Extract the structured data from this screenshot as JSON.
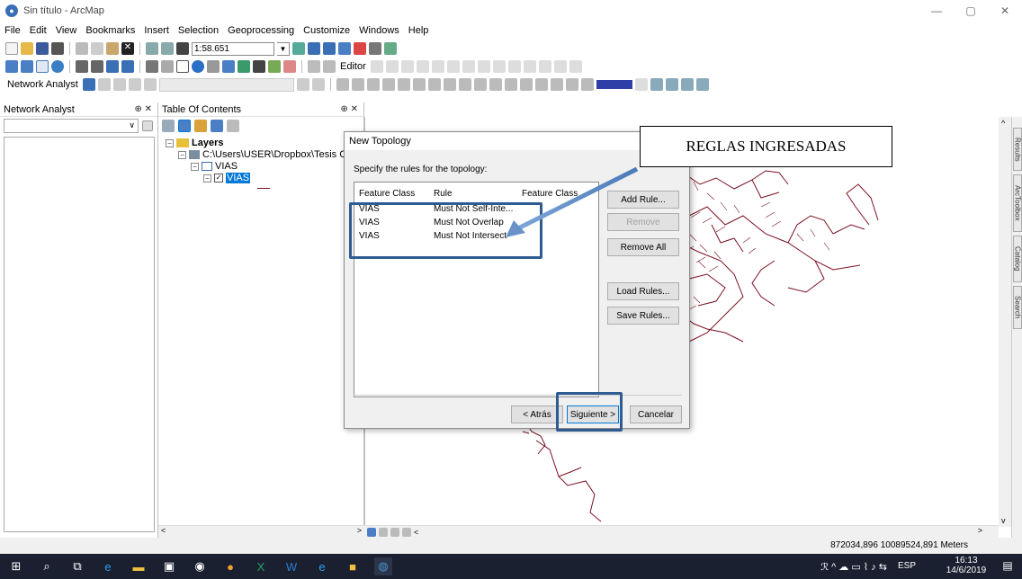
{
  "window": {
    "title": "Sin título - ArcMap"
  },
  "menu": [
    "File",
    "Edit",
    "View",
    "Bookmarks",
    "Insert",
    "Selection",
    "Geoprocessing",
    "Customize",
    "Windows",
    "Help"
  ],
  "toolbar": {
    "scale": "1:58.651",
    "editor_label": "Editor",
    "network_analyst_label": "Network Analyst"
  },
  "network_analyst_panel": {
    "title": "Network Analyst"
  },
  "toc": {
    "title": "Table Of Contents",
    "layers_label": "Layers",
    "path_label": "C:\\Users\\USER\\Dropbox\\Tesis Casc",
    "group_label": "VIAS",
    "layer_label": "VIAS"
  },
  "dialog": {
    "title": "New Topology",
    "prompt": "Specify the rules for the topology:",
    "columns": [
      "Feature Class",
      "Rule",
      "Feature Class"
    ],
    "rules": [
      {
        "feature_class": "VIAS",
        "rule": "Must Not Self-Inte..."
      },
      {
        "feature_class": "VIAS",
        "rule": "Must Not Overlap"
      },
      {
        "feature_class": "VIAS",
        "rule": "Must Not Intersect"
      }
    ],
    "buttons": {
      "add_rule": "Add Rule...",
      "remove": "Remove",
      "remove_all": "Remove All",
      "load_rules": "Load Rules...",
      "save_rules": "Save Rules...",
      "back": "< Atrás",
      "next": "Siguiente >",
      "cancel": "Cancelar"
    }
  },
  "annotation": {
    "text": "REGLAS INGRESADAS"
  },
  "side_tabs": [
    "Results",
    "ArcToolbox",
    "Catalog",
    "Search"
  ],
  "status": {
    "coordinates": "872034,896 10089524,891 Meters"
  },
  "taskbar": {
    "lang": "ESP",
    "time": "16:13",
    "date": "14/6/2019",
    "notify_count": "1"
  },
  "colors": {
    "map_lines": "#7a1020",
    "highlight": "#2e5c92",
    "selection": "#0078d7"
  }
}
